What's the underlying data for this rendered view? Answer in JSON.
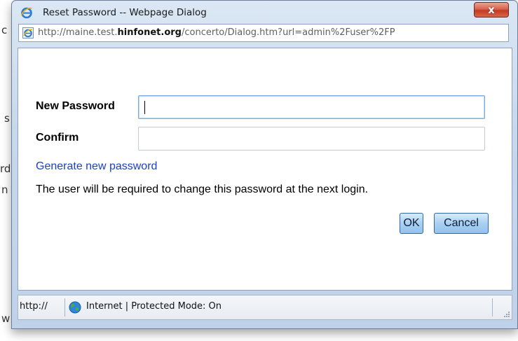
{
  "background_page": {
    "fragments": [
      "c",
      "s",
      "rd",
      "n",
      "w"
    ]
  },
  "window": {
    "title": "Reset Password -- Webpage Dialog",
    "close_label": "x",
    "icons": {
      "title": "ie-icon",
      "address": "ie-page-icon",
      "status": "globe-icon"
    }
  },
  "address_bar": {
    "url_prefix": "http://maine.test.",
    "url_domain": "hinfonet.org",
    "url_suffix": "/concerto/Dialog.htm?url=admin%2Fuser%2FP"
  },
  "form": {
    "new_password_label": "New Password",
    "new_password_value": "",
    "confirm_label": "Confirm",
    "confirm_value": "",
    "generate_link": "Generate new password",
    "note": "The user will be required to change this password at the next login.",
    "ok_label": "OK",
    "cancel_label": "Cancel"
  },
  "status_bar": {
    "url": "http://",
    "zone": "Internet | Protected Mode: On"
  },
  "colors": {
    "link": "#1a3fcf",
    "close_button": "#c23a22",
    "button_fill": "#a9d0f2"
  }
}
